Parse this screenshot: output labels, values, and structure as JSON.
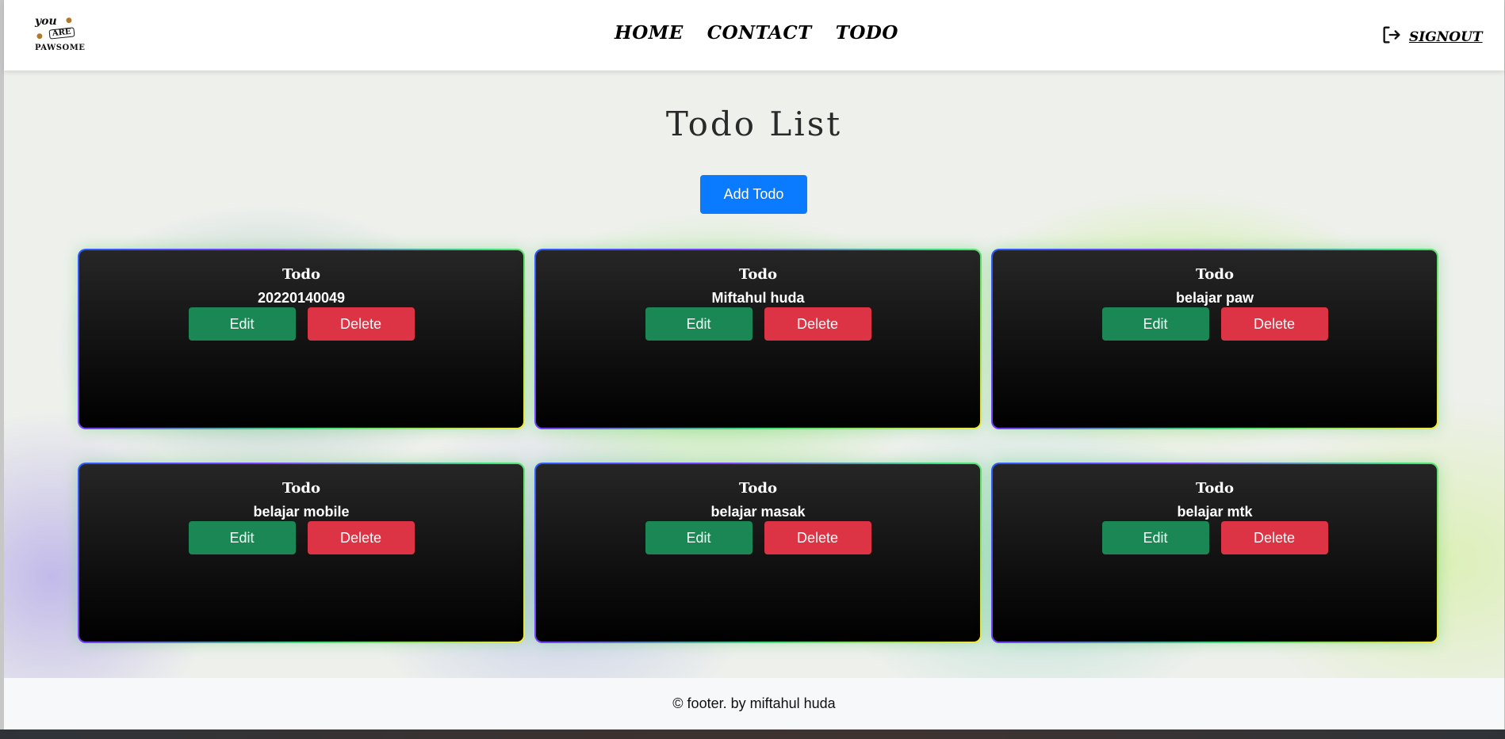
{
  "brand": {
    "logo_line1": "you",
    "logo_line2": "ARE",
    "logo_line3": "PAWSOME"
  },
  "nav": {
    "links": [
      "HOME",
      "CONTACT",
      "TODO"
    ],
    "signout_label": "SIGNOUT"
  },
  "main": {
    "title": "Todo List",
    "add_button": "Add Todo"
  },
  "todos": [
    {
      "label": "Todo",
      "title": "20220140049",
      "edit": "Edit",
      "delete": "Delete"
    },
    {
      "label": "Todo",
      "title": "Miftahul huda",
      "edit": "Edit",
      "delete": "Delete"
    },
    {
      "label": "Todo",
      "title": "belajar paw",
      "edit": "Edit",
      "delete": "Delete"
    },
    {
      "label": "Todo",
      "title": "belajar mobile",
      "edit": "Edit",
      "delete": "Delete"
    },
    {
      "label": "Todo",
      "title": "belajar masak",
      "edit": "Edit",
      "delete": "Delete"
    },
    {
      "label": "Todo",
      "title": "belajar mtk",
      "edit": "Edit",
      "delete": "Delete"
    }
  ],
  "footer": {
    "text": "© footer. by miftahul huda"
  },
  "colors": {
    "primary": "#0a7bff",
    "edit": "#1b8754",
    "delete": "#dc3445"
  }
}
